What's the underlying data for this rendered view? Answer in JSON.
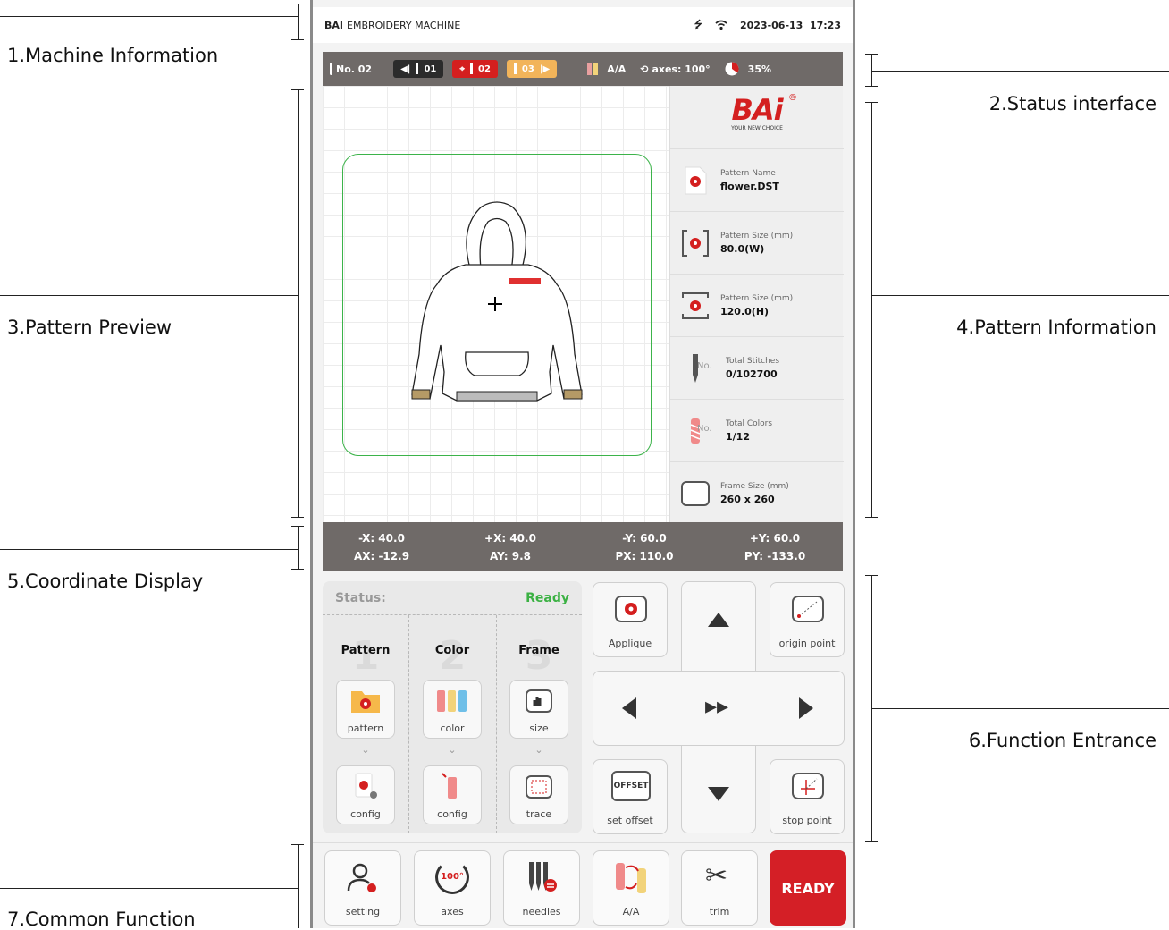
{
  "annotations": {
    "machine_info": "1.Machine Information",
    "status_interface": "2.Status interface",
    "pattern_preview": "3.Pattern Preview",
    "pattern_information": "4.Pattern Information",
    "coordinate_display": "5.Coordinate Display",
    "function_entrance": "6.Function Entrance",
    "common_function": "7.Common Function"
  },
  "topbar": {
    "brand": "BAI",
    "title": "EMBROIDERY MACHINE",
    "datetime": "2023-06-13  17:23",
    "icons": [
      "usb-icon",
      "wifi-icon"
    ]
  },
  "statusbar": {
    "needle_no": "No. 02",
    "prev_needle": "01",
    "current_needle": "02",
    "next_needle": "03",
    "thread_mode": "A/A",
    "axes": "axes: 100°",
    "progress": "35%",
    "progress_fraction": 0.35,
    "colors": {
      "dark": "#2b2b2b",
      "red": "#d41f1f",
      "orange": "#f2b45a"
    }
  },
  "logo": {
    "text": "BAi",
    "reg": "®",
    "tagline": "YOUR NEW CHOICE"
  },
  "pattern_info": [
    {
      "label": "Pattern Name",
      "value": "flower.DST",
      "icon": "pattern-file-icon"
    },
    {
      "label": "Pattern Size (mm)",
      "value": "80.0(W)",
      "icon": "width-icon"
    },
    {
      "label": "Pattern Size (mm)",
      "value": "120.0(H)",
      "icon": "height-icon"
    },
    {
      "label": "Total Stitches",
      "value": "0/102700",
      "icon": "needle-icon",
      "badge": "No."
    },
    {
      "label": "Total Colors",
      "value": "1/12",
      "icon": "thread-icon",
      "badge": "No."
    },
    {
      "label": "Frame Size (mm)",
      "value": "260 x 260",
      "icon": "frame-icon"
    }
  ],
  "coords": {
    "neg_x": "-X: 40.0",
    "pos_x": "+X: 40.0",
    "neg_y": "-Y: 60.0",
    "pos_y": "+Y: 60.0",
    "ax": "AX: -12.9",
    "ay": "AY: 9.8",
    "px": "PX: 110.0",
    "py": "PY: -133.0"
  },
  "panel": {
    "status_label": "Status:",
    "status_value": "Ready",
    "steps": [
      {
        "num": "1",
        "title": "Pattern",
        "top_label": "pattern",
        "bottom_label": "config"
      },
      {
        "num": "2",
        "title": "Color",
        "top_label": "color",
        "bottom_label": "config"
      },
      {
        "num": "3",
        "title": "Frame",
        "top_label": "size",
        "bottom_label": "trace"
      }
    ],
    "chevron": "⌄"
  },
  "dpad": {
    "applique": "Applique",
    "origin_point": "origin point",
    "set_offset": "set offset",
    "offset_text": "OFFSET",
    "stop_point": "stop point"
  },
  "common": {
    "setting": "setting",
    "axes": "axes",
    "axes_value": "100°",
    "needles": "needles",
    "aa": "A/A",
    "trim": "trim",
    "ready": "READY",
    "ready_color": "#d41f26"
  }
}
